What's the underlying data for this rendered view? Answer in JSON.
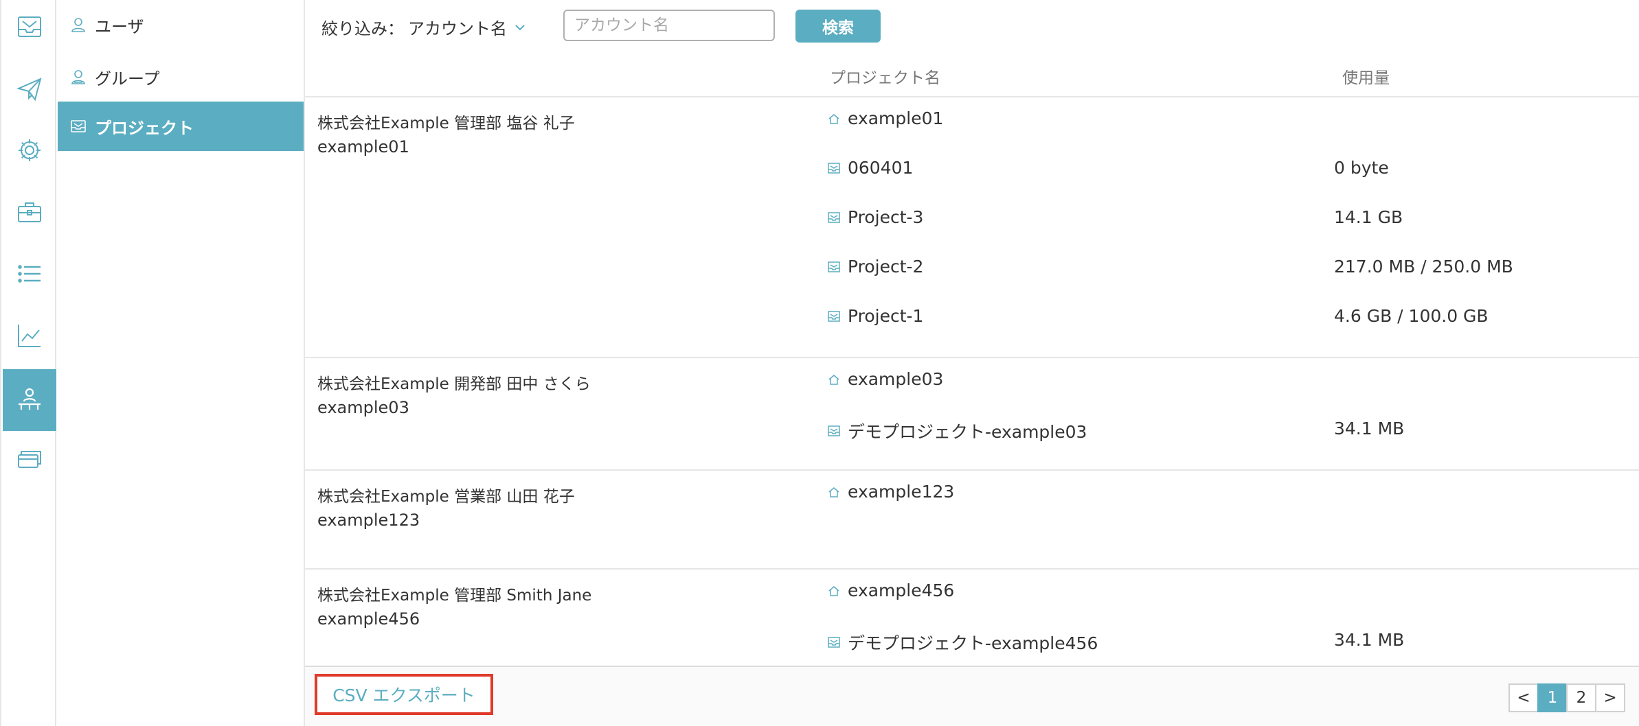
{
  "colors": {
    "accent": "#5badc1",
    "highlight_border": "#e03a2a"
  },
  "rail": {
    "items": [
      {
        "icon": "inbox-icon"
      },
      {
        "icon": "paper-plane-icon"
      },
      {
        "icon": "gear-icon"
      },
      {
        "icon": "toolbox-icon"
      },
      {
        "icon": "list-icon"
      },
      {
        "icon": "line-chart-icon"
      },
      {
        "icon": "org-chart-icon",
        "active": true
      },
      {
        "icon": "cards-icon"
      }
    ]
  },
  "subnav": {
    "items": [
      {
        "label": "ユーザ",
        "icon": "user-icon"
      },
      {
        "label": "グループ",
        "icon": "group-icon"
      },
      {
        "label": "プロジェクト",
        "icon": "project-icon",
        "active": true
      }
    ]
  },
  "filter": {
    "label": "絞り込み：",
    "select_value": "アカウント名",
    "input_placeholder": "アカウント名",
    "search_button": "検索"
  },
  "table": {
    "col_project": "プロジェクト名",
    "col_usage": "使用量",
    "groups": [
      {
        "name": "株式会社Example 管理部 塩谷 礼子",
        "account": "example01",
        "projects": [
          {
            "name": "example01",
            "icon": "home-icon",
            "usage": ""
          },
          {
            "name": "060401",
            "icon": "project-icon",
            "usage": "0 byte"
          },
          {
            "name": "Project-3",
            "icon": "project-icon",
            "usage": "14.1 GB"
          },
          {
            "name": "Project-2",
            "icon": "project-icon",
            "usage": "217.0 MB / 250.0 MB"
          },
          {
            "name": "Project-1",
            "icon": "project-icon",
            "usage": "4.6 GB / 100.0 GB"
          }
        ]
      },
      {
        "name": "株式会社Example 開発部 田中 さくら",
        "account": "example03",
        "projects": [
          {
            "name": "example03",
            "icon": "home-icon",
            "usage": ""
          },
          {
            "name": "デモプロジェクト-example03",
            "icon": "project-icon",
            "usage": "34.1 MB"
          }
        ]
      },
      {
        "name": "株式会社Example 営業部 山田 花子",
        "account": "example123",
        "projects": [
          {
            "name": "example123",
            "icon": "home-icon",
            "usage": ""
          }
        ]
      },
      {
        "name": "株式会社Example 管理部 Smith Jane",
        "account": "example456",
        "projects": [
          {
            "name": "example456",
            "icon": "home-icon",
            "usage": ""
          },
          {
            "name": "デモプロジェクト-example456",
            "icon": "project-icon",
            "usage": "34.1 MB"
          }
        ]
      }
    ]
  },
  "footer": {
    "csv_export": "CSV エクスポート",
    "pagination": {
      "prev": "<",
      "pages": [
        "1",
        "2"
      ],
      "current": "1",
      "next": ">"
    }
  }
}
